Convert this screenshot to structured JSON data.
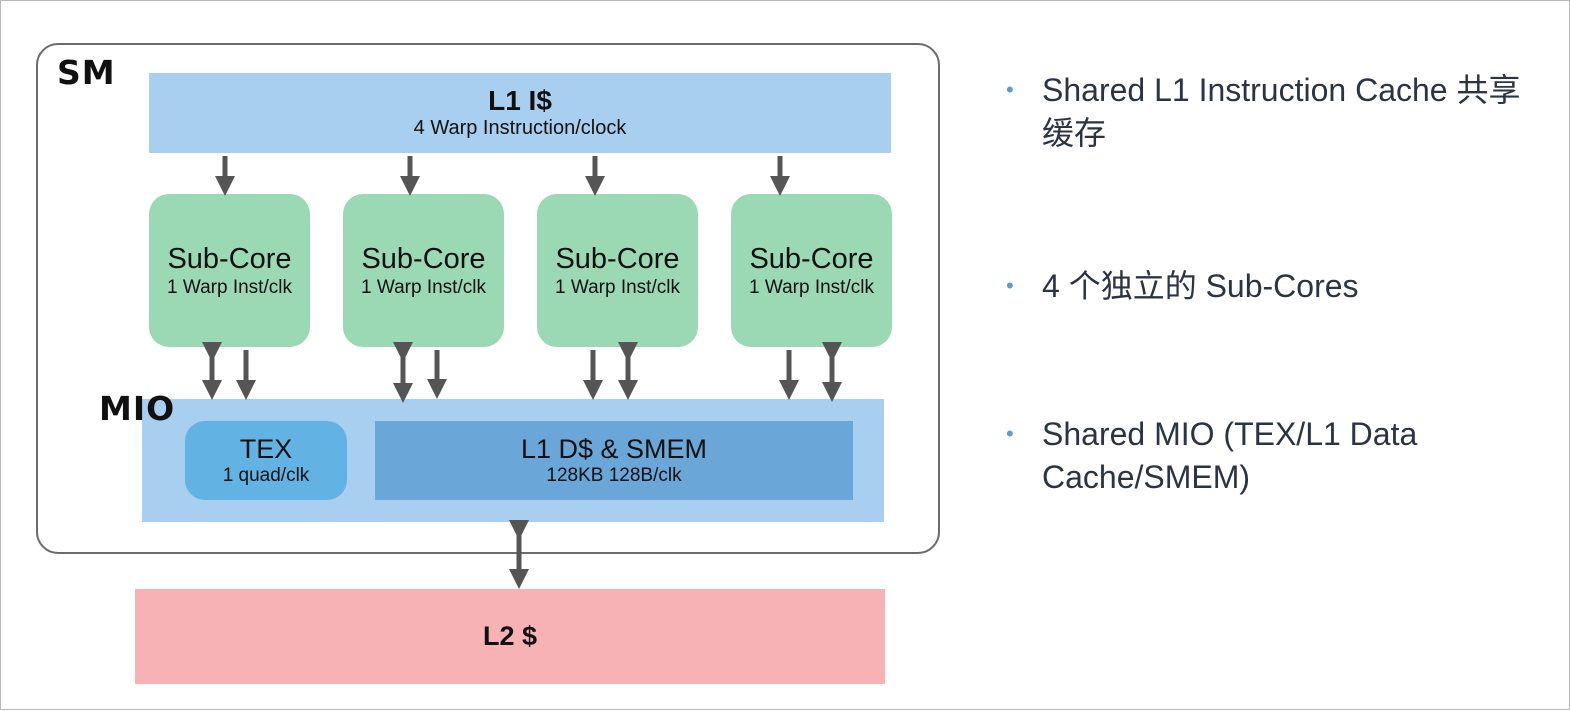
{
  "diagram": {
    "sm_label": "SM",
    "mio_label": "MIO",
    "l1i": {
      "title": "L1 I$",
      "subtitle": "4 Warp Instruction/clock"
    },
    "subcores": [
      {
        "title": "Sub-Core",
        "subtitle": "1 Warp Inst/clk"
      },
      {
        "title": "Sub-Core",
        "subtitle": "1 Warp Inst/clk"
      },
      {
        "title": "Sub-Core",
        "subtitle": "1 Warp Inst/clk"
      },
      {
        "title": "Sub-Core",
        "subtitle": "1 Warp Inst/clk"
      }
    ],
    "tex": {
      "title": "TEX",
      "subtitle": "1 quad/clk"
    },
    "l1d": {
      "title": "L1 D$ & SMEM",
      "subtitle": "128KB 128B/clk"
    },
    "l2": {
      "title": "L2 $"
    },
    "colors": {
      "l1i": "#a8cff0",
      "subcore": "#9bd9b5",
      "mio": "#a8cff0",
      "tex": "#62b3e4",
      "l1d": "#6aa6d7",
      "l2": "#f6b2b4",
      "arrow": "#555555"
    }
  },
  "bullets": [
    "Shared L1 Instruction Cache 共享缓存",
    "4 个独立的 Sub-Cores",
    "Shared MIO (TEX/L1 Data Cache/SMEM)"
  ],
  "bullet_color": "#5b9bd5"
}
